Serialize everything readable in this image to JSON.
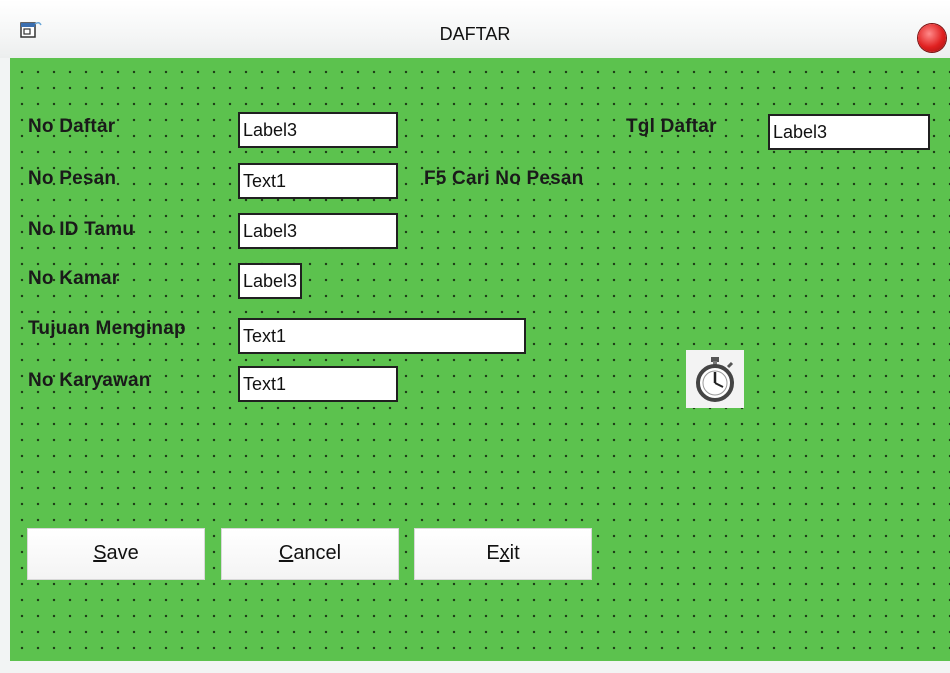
{
  "window": {
    "title": "DAFTAR",
    "accent_color": "#5cc24e",
    "close_color": "#e02020"
  },
  "form": {
    "no_daftar": {
      "label": "No Daftar",
      "value": "Label3"
    },
    "tgl_daftar": {
      "label": "Tgl Daftar",
      "value": "Label3"
    },
    "no_pesan": {
      "label": "No Pesan",
      "value": "Text1"
    },
    "hint": "F5 Cari No Pesan",
    "no_id_tamu": {
      "label": "No ID Tamu",
      "value": "Label3"
    },
    "no_kamar": {
      "label": "No Kamar",
      "value": "Label3"
    },
    "tujuan_menginap": {
      "label": "Tujuan Menginap",
      "value": "Text1"
    },
    "no_karyawan": {
      "label": "No Karyawan",
      "value": "Text1"
    },
    "timer_icon": "stopwatch-icon"
  },
  "buttons": {
    "save": {
      "mnemonic": "S",
      "rest": "ave"
    },
    "cancel": {
      "mnemonic": "C",
      "rest": "ancel"
    },
    "exit": {
      "pre": "E",
      "mnemonic": "x",
      "rest": "it"
    }
  }
}
